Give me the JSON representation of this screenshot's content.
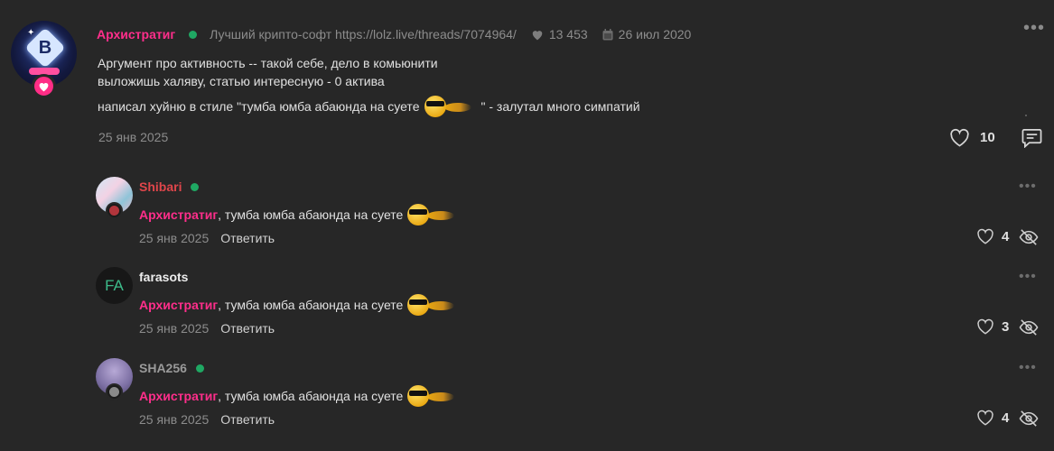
{
  "post": {
    "author": "Архистратиг",
    "user_title": "Лучший крипто-софт https://lolz.live/threads/7074964/",
    "likes_total": "13 453",
    "joined": "26 июл 2020",
    "text_line1": "Аргумент про активность -- такой себе, дело в комьюнити",
    "text_line2": "выложишь халяву, статью интересную - 0 актива",
    "text_line3_a": "написал хуйню в стиле \"тумба юмба абаюнда на суете",
    "text_line3_b": "\" - залутал много симпатий",
    "date": "25 янв 2025",
    "likes": "10"
  },
  "comments": [
    {
      "author": "Shibari",
      "author_color": "#e0464b",
      "online": true,
      "mention": "Архистратиг",
      "text": ", тумба юмба абаюнда на суете",
      "date": "25 янв 2025",
      "reply_label": "Ответить",
      "likes": "4"
    },
    {
      "author": "farasots",
      "author_color": "#ededed",
      "online": false,
      "avatar_text": "FA",
      "mention": "Архистратиг",
      "text": ", тумба юмба абаюнда на суете",
      "date": "25 янв 2025",
      "reply_label": "Ответить",
      "likes": "3"
    },
    {
      "author": "SHA256",
      "author_color": "#9a9a9a",
      "online": true,
      "mention": "Архистратиг",
      "text": ", тумба юмба абаюнда на суете",
      "date": "25 янв 2025",
      "reply_label": "Ответить",
      "likes": "4"
    }
  ],
  "colors": {
    "background": "#272727",
    "accent_pink": "#ff2e8b",
    "online_green": "#1fa863"
  },
  "icons": [
    "heart-icon",
    "calendar-icon",
    "more-icon",
    "reply-icon",
    "eye-off-icon",
    "smiley-sunglasses-emoji"
  ]
}
